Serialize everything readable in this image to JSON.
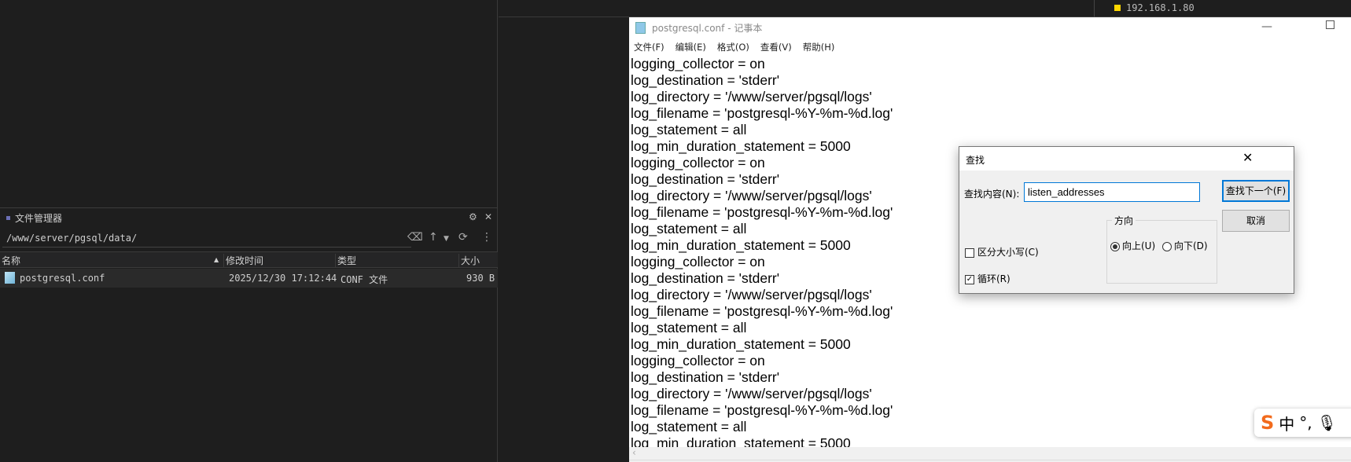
{
  "top_bar": {
    "ip": "192.168.1.80",
    "ip_color": "#ffd700"
  },
  "file_manager": {
    "title": "文件管理器",
    "path": "/www/server/pgsql/data/",
    "columns": [
      "名称",
      "修改时间",
      "类型",
      "大小"
    ],
    "rows": [
      {
        "name": "postgresql.conf",
        "modified": "2025/12/30 17:12:44",
        "type": "CONF 文件",
        "size": "930 B"
      }
    ]
  },
  "notepad": {
    "title": "postgresql.conf - 记事本",
    "menu": [
      "文件(F)",
      "编辑(E)",
      "格式(O)",
      "查看(V)",
      "帮助(H)"
    ],
    "lines": [
      "logging_collector = on",
      "log_destination = 'stderr'",
      "log_directory = '/www/server/pgsql/logs'",
      "log_filename = 'postgresql-%Y-%m-%d.log'",
      "log_statement = all",
      "log_min_duration_statement = 5000",
      "logging_collector = on",
      "log_destination = 'stderr'",
      "log_directory = '/www/server/pgsql/logs'",
      "log_filename = 'postgresql-%Y-%m-%d.log'",
      "log_statement = all",
      "log_min_duration_statement = 5000",
      "logging_collector = on",
      "log_destination = 'stderr'",
      "log_directory = '/www/server/pgsql/logs'",
      "log_filename = 'postgresql-%Y-%m-%d.log'",
      "log_statement = all",
      "log_min_duration_statement = 5000",
      "logging_collector = on",
      "log_destination = 'stderr'",
      "log_directory = '/www/server/pgsql/logs'",
      "log_filename = 'postgresql-%Y-%m-%d.log'",
      "log_statement = all",
      "log_min_duration_statement = 5000"
    ]
  },
  "find_dialog": {
    "title": "查找",
    "label": "查找内容(N):",
    "value": "listen_addresses",
    "find_next": "查找下一个(F)",
    "cancel": "取消",
    "direction_label": "方向",
    "up": "向上(U)",
    "down": "向下(D)",
    "direction": "up",
    "match_case": "区分大小写(C)",
    "match_case_checked": false,
    "wrap": "循环(R)",
    "wrap_checked": true
  },
  "ime": {
    "logo": "S",
    "mode": "中",
    "punct": "°,"
  }
}
